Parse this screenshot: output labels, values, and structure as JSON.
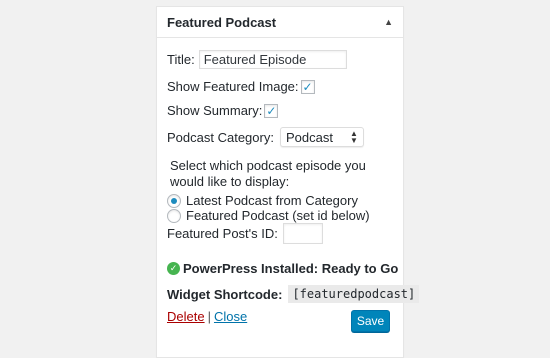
{
  "widget": {
    "title": "Featured Podcast",
    "toggle_icon": "▲"
  },
  "form": {
    "title_label": "Title:",
    "title_value": "Featured Episode",
    "show_image_label": "Show Featured Image:",
    "show_image_checked": true,
    "show_summary_label": "Show Summary:",
    "show_summary_checked": true,
    "category_label": "Podcast Category:",
    "category_selected": "Podcast",
    "instructions": "Select which podcast episode you would like to display:",
    "radio_options": [
      {
        "label": "Latest Podcast from Category",
        "selected": true
      },
      {
        "label": "Featured Podcast (set id below)",
        "selected": false
      }
    ],
    "post_id_label": "Featured Post's ID:",
    "post_id_value": "",
    "status_text": "PowerPress Installed: Ready to Go",
    "shortcode_label": "Widget Shortcode:",
    "shortcode_value": "[featuredpodcast]"
  },
  "actions": {
    "delete_label": "Delete",
    "separator": "|",
    "close_label": "Close",
    "save_label": "Save"
  },
  "colors": {
    "accent": "#1e8cbe",
    "save_button": "#0085ba",
    "delete_link": "#aa0000",
    "close_link": "#0073aa",
    "ok_green": "#46b450"
  }
}
